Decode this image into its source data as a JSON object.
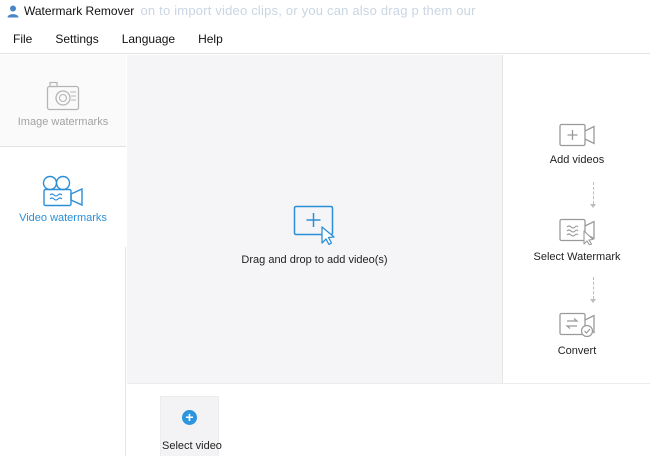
{
  "window": {
    "title": "Watermark Remover",
    "background_text": "button to import video clips, or you can also drag p them our"
  },
  "menu": [
    "File",
    "Settings",
    "Language",
    "Help"
  ],
  "sidebar": {
    "items": [
      {
        "label": "Image watermarks",
        "icon": "camera-icon",
        "active": false
      },
      {
        "label": "Video watermarks",
        "icon": "video-camera-icon",
        "active": true
      }
    ]
  },
  "dropzone": {
    "label": "Drag and drop to add video(s)",
    "icon": "add-video-cursor-icon"
  },
  "steps": [
    {
      "label": "Add videos",
      "icon": "add-video-icon"
    },
    {
      "label": "Select Watermark",
      "icon": "select-watermark-icon"
    },
    {
      "label": "Convert",
      "icon": "convert-icon"
    }
  ],
  "bottom": {
    "select_video_label": "Select video"
  },
  "colors": {
    "accent": "#2b8fd8",
    "dropzone_bg": "#f5f5f7",
    "inactive_text": "#a3a3a3"
  }
}
